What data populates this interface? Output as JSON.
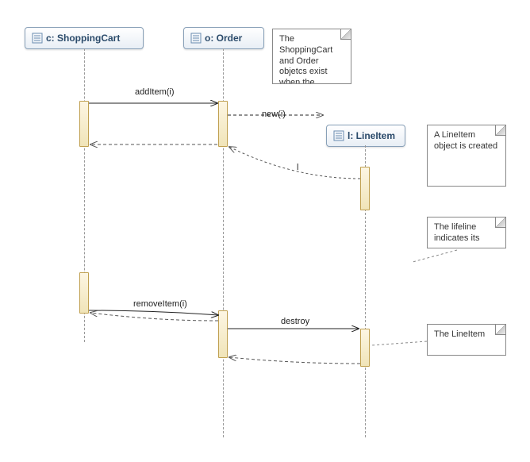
{
  "participants": {
    "cart": {
      "label": "c: ShoppingCart"
    },
    "order": {
      "label": "o: Order"
    },
    "lineItem": {
      "label": "l: LineItem"
    }
  },
  "messages": {
    "m1": {
      "label": "addItem(i)"
    },
    "m2": {
      "label": "new(i)"
    },
    "m3": {
      "label": "l"
    },
    "m4": {
      "label": "removeItem(i)"
    },
    "m5": {
      "label": "destroy"
    }
  },
  "notes": {
    "n1": "The ShoppingCart and Order objetcs exist when the",
    "n2": "A LineItem object is created",
    "n3": "The lifeline indicates its",
    "n4": "The LineItem"
  },
  "chart_data": {
    "type": "sequence-diagram",
    "participants": [
      {
        "id": "c",
        "name": "c: ShoppingCart",
        "created_at_start": true
      },
      {
        "id": "o",
        "name": "o: Order",
        "created_at_start": true
      },
      {
        "id": "l",
        "name": "l: LineItem",
        "created_at_start": false
      }
    ],
    "messages": [
      {
        "from": "c",
        "to": "o",
        "label": "addItem(i)",
        "kind": "call"
      },
      {
        "from": "o",
        "to": "l",
        "label": "new(i)",
        "kind": "create"
      },
      {
        "from": "l",
        "to": "o",
        "label": "l",
        "kind": "return"
      },
      {
        "from": "o",
        "to": "c",
        "label": "",
        "kind": "return"
      },
      {
        "from": "c",
        "to": "o",
        "label": "removeItem(i)",
        "kind": "call"
      },
      {
        "from": "o",
        "to": "c",
        "label": "",
        "kind": "return"
      },
      {
        "from": "o",
        "to": "l",
        "label": "destroy",
        "kind": "destroy"
      },
      {
        "from": "l",
        "to": "o",
        "label": "",
        "kind": "return"
      }
    ],
    "notes": [
      {
        "text": "The ShoppingCart and Order objetcs exist when the",
        "attach": [
          "c",
          "o"
        ]
      },
      {
        "text": "A LineItem object is created",
        "attach": [
          "l"
        ]
      },
      {
        "text": "The lifeline indicates its",
        "attach": [
          "l"
        ]
      },
      {
        "text": "The LineItem",
        "attach": [
          "l"
        ]
      }
    ]
  }
}
